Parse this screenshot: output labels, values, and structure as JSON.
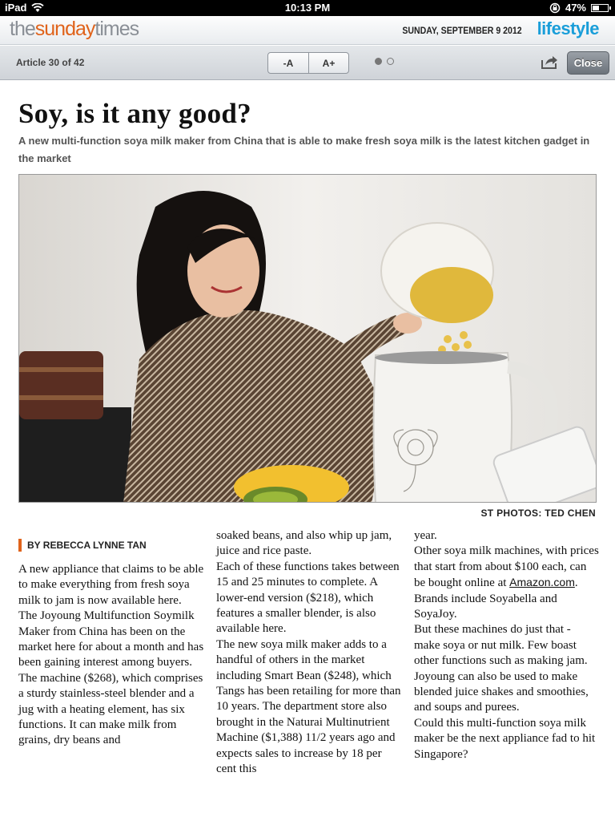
{
  "status_bar": {
    "device": "iPad",
    "time": "10:13 PM",
    "battery": "47%",
    "battery_level": 0.47
  },
  "masthead": {
    "brand_the": "the",
    "brand_sunday": "sunday",
    "brand_times": "times",
    "date": "SUNDAY, SEPTEMBER 9 2012",
    "section": "lifestyle"
  },
  "toolbar": {
    "article_count": "Article 30 of 42",
    "font_smaller": "-A",
    "font_larger": "A+",
    "close_label": "Close",
    "page_dots": 2,
    "active_dot": 0
  },
  "article": {
    "headline": "Soy, is it any good?",
    "standfirst": "A new multi-function soya milk maker from China that is able to make fresh soya milk is the latest kitchen gadget in the market",
    "photo_credit": "ST PHOTOS: TED CHEN",
    "byline": "BY REBECCA LYNNE TAN",
    "col1": [
      "A new appliance that claims to be able to make everything from fresh soya milk to jam is now available here.",
      " The Joyoung Multifunction Soymilk Maker from China has been on the market here for about a month and has been gaining interest among buyers.",
      " The machine ($268), which comprises a sturdy stainless-steel blender and a jug with a heating element, has six functions. It can make milk from grains, dry beans and"
    ],
    "col2": [
      "soaked beans, and also whip up jam, juice and rice paste.",
      " Each of these functions takes between 15 and 25 minutes to complete. A lower-end version ($218), which features a smaller blender, is also available here.",
      " The new soya milk maker adds to a handful of others in the market including Smart Bean ($248), which Tangs has been retailing for more than 10 years. The department store also brought in the Naturai Multinutrient Machine ($1,388) 11/2 years ago and expects sales to increase by 18 per cent this"
    ],
    "col3_p1": "year.",
    "col3_p2_before": " Other soya milk machines, with prices that start from about $100 each, can be bought online at ",
    "col3_p2_link": "Amazon.com",
    "col3_p2_after": ". Brands include Soyabella and SoyaJoy.",
    "col3": [
      " But these machines do just that - make soya or nut milk. Few boast other functions such as making jam.",
      " Joyoung can also be used to make blended juice shakes and smoothies, and soups and purees.",
      " Could this multi-function soya milk maker be the next appliance fad to hit Singapore?"
    ]
  }
}
